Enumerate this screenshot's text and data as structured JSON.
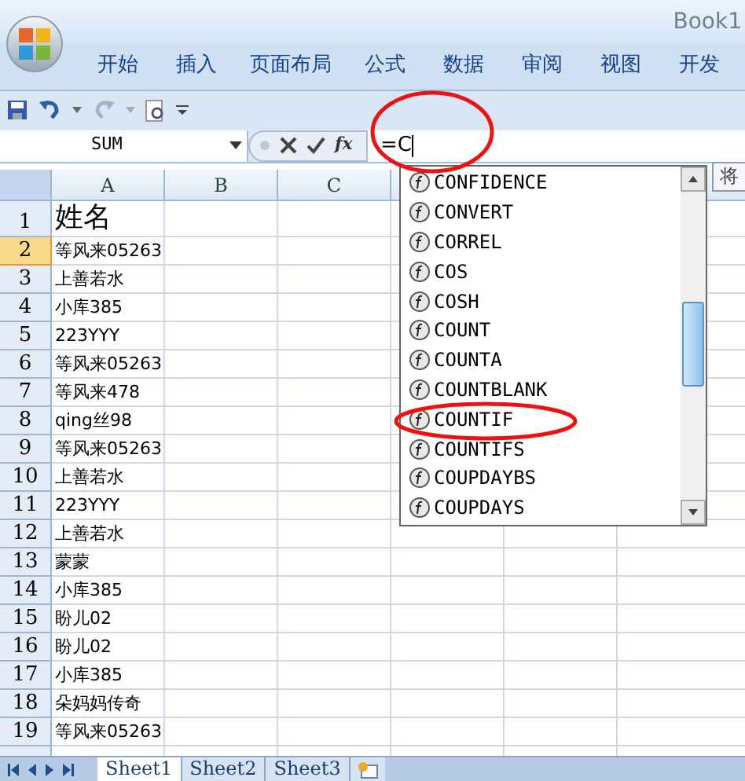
{
  "window": {
    "title": "Book1"
  },
  "ribbon_tabs": [
    {
      "label": "开始"
    },
    {
      "label": "插入"
    },
    {
      "label": "页面布局"
    },
    {
      "label": "公式"
    },
    {
      "label": "数据"
    },
    {
      "label": "审阅"
    },
    {
      "label": "视图"
    },
    {
      "label": "开发"
    }
  ],
  "formula_bar": {
    "name_box": "SUM",
    "fx_label": "fx",
    "value": "=C"
  },
  "columns": [
    "A",
    "B",
    "C"
  ],
  "rows": [
    {
      "number": "1",
      "selected": false,
      "cell_a": "姓名"
    },
    {
      "number": "2",
      "selected": true,
      "cell_a": "等风来05263"
    },
    {
      "number": "3",
      "selected": false,
      "cell_a": "上善若水"
    },
    {
      "number": "4",
      "selected": false,
      "cell_a": "小库385"
    },
    {
      "number": "5",
      "selected": false,
      "cell_a": "223YYY"
    },
    {
      "number": "6",
      "selected": false,
      "cell_a": "等风来05263"
    },
    {
      "number": "7",
      "selected": false,
      "cell_a": "等风来478"
    },
    {
      "number": "8",
      "selected": false,
      "cell_a": "qing丝98"
    },
    {
      "number": "9",
      "selected": false,
      "cell_a": "等风来05263"
    },
    {
      "number": "10",
      "selected": false,
      "cell_a": "上善若水"
    },
    {
      "number": "11",
      "selected": false,
      "cell_a": "223YYY"
    },
    {
      "number": "12",
      "selected": false,
      "cell_a": "上善若水"
    },
    {
      "number": "13",
      "selected": false,
      "cell_a": "蒙蒙"
    },
    {
      "number": "14",
      "selected": false,
      "cell_a": "小库385"
    },
    {
      "number": "15",
      "selected": false,
      "cell_a": "盼儿02"
    },
    {
      "number": "16",
      "selected": false,
      "cell_a": "盼儿02"
    },
    {
      "number": "17",
      "selected": false,
      "cell_a": "小库385"
    },
    {
      "number": "18",
      "selected": false,
      "cell_a": "朵妈妈传奇"
    },
    {
      "number": "19",
      "selected": false,
      "cell_a": "等风来05263"
    }
  ],
  "autocomplete": {
    "items": [
      {
        "label": "CONFIDENCE",
        "selected": false
      },
      {
        "label": "CONVERT",
        "selected": false
      },
      {
        "label": "CORREL",
        "selected": false
      },
      {
        "label": "COS",
        "selected": false
      },
      {
        "label": "COSH",
        "selected": false
      },
      {
        "label": "COUNT",
        "selected": false
      },
      {
        "label": "COUNTA",
        "selected": false
      },
      {
        "label": "COUNTBLANK",
        "selected": false
      },
      {
        "label": "COUNTIF",
        "selected": false
      },
      {
        "label": "COUNTIFS",
        "selected": false
      },
      {
        "label": "COUPDAYBS",
        "selected": false
      },
      {
        "label": "COUPDAYS",
        "selected": false
      }
    ],
    "tooltip": "将"
  },
  "sheet_tabs": [
    {
      "label": "Sheet1",
      "selected": true
    },
    {
      "label": "Sheet2",
      "selected": false
    },
    {
      "label": "Sheet3",
      "selected": false
    }
  ]
}
